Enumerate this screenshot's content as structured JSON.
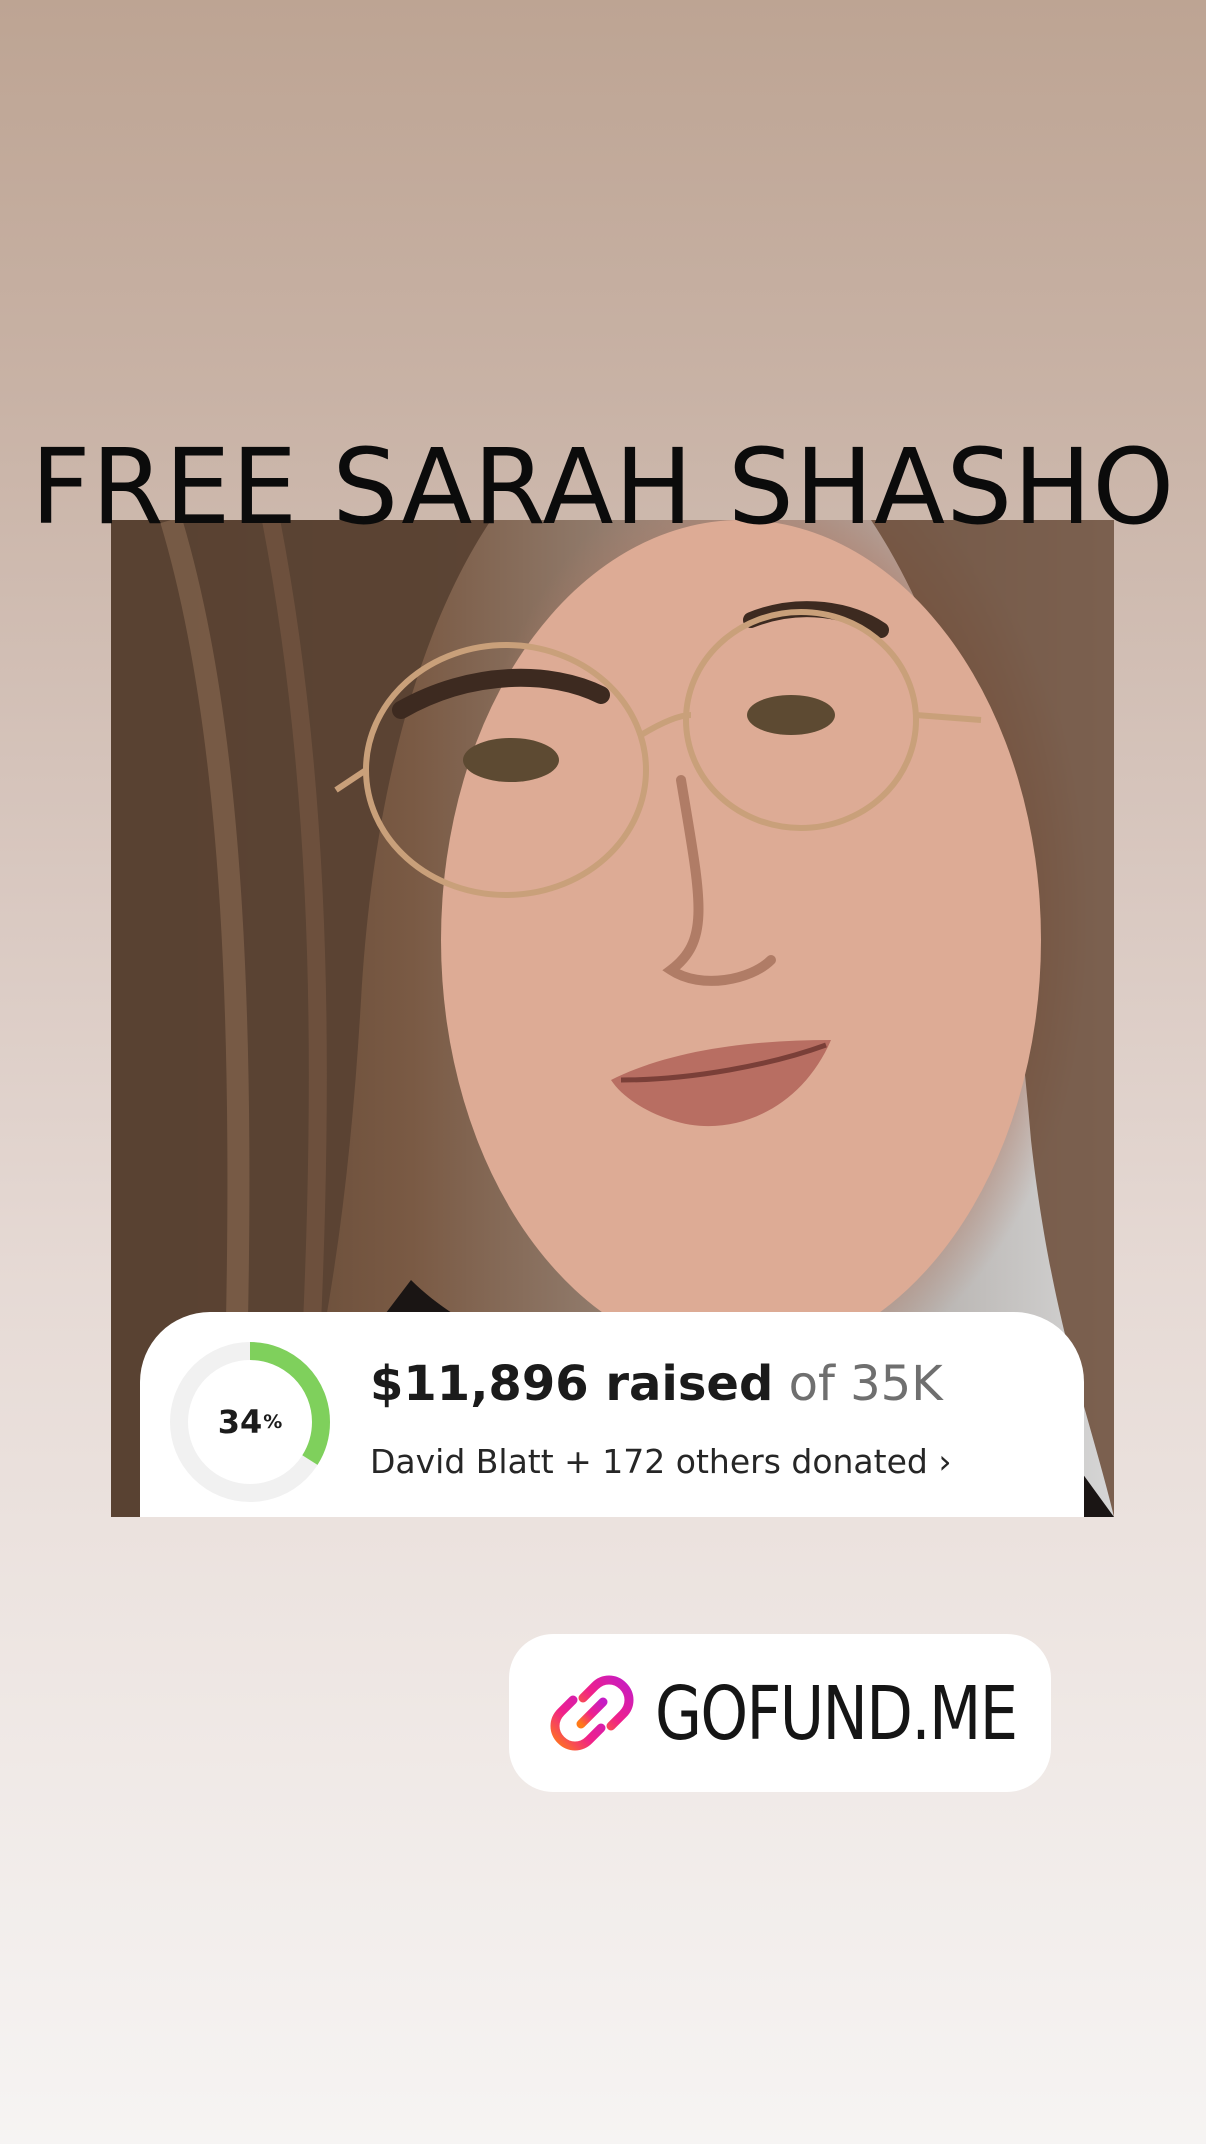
{
  "story": {
    "title": "FREE SARAH SHASHO"
  },
  "fundraiser_card": {
    "progress_percent": 34,
    "percent_label": "34",
    "percent_sign": "%",
    "amount_raised": "$11,896 raised",
    "goal_text": "of 35K",
    "donors_text": "David Blatt + 172 others donated",
    "donors_chevron": "›",
    "progress_color": "#7fd05c",
    "track_color": "#f1f1f1"
  },
  "link_sticker": {
    "label": "GOFUND.ME",
    "icon": "link-icon"
  }
}
